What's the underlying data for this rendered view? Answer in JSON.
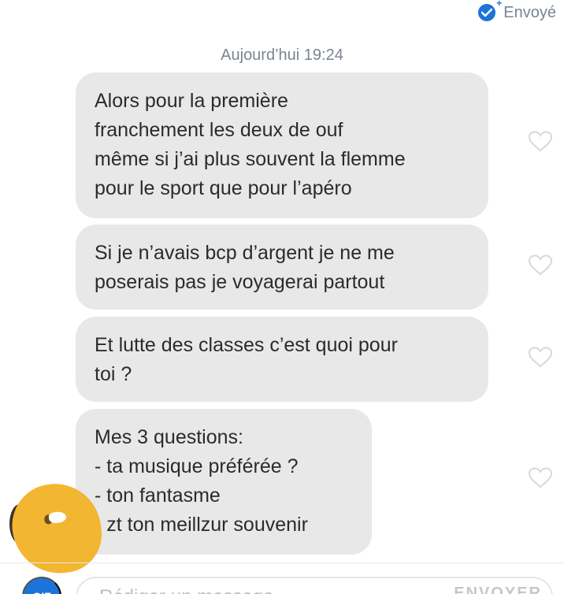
{
  "header": {
    "status_text": "Envoyé",
    "status_icon": "sent-check-icon"
  },
  "conversation": {
    "date_label": "Aujourd’hui 19:24",
    "messages": [
      {
        "text": "Alors pour la première\nfranchement les deux de ouf\nmême si j’ai plus souvent la flemme\npour le sport que pour l’apéro",
        "like_icon": "heart-outline-icon"
      },
      {
        "text": "Si je n’avais bcp d’argent je ne me\nposerais pas je voyagerai partout",
        "like_icon": "heart-outline-icon"
      },
      {
        "text": "Et lutte des classes c’est quoi pour\ntoi ?",
        "like_icon": "heart-outline-icon"
      },
      {
        "text": "Mes 3 questions:\n- ta musique préférée ?\n- ton fantasme\n- zt ton meillzur souvenir",
        "like_icon": "heart-outline-icon"
      }
    ]
  },
  "composer": {
    "gif_label": "GIF",
    "input_placeholder": "Rédiger un message",
    "send_label": "ENVOYER"
  },
  "colors": {
    "accent": "#1e73d8",
    "bubble_bg": "#e8e8e8",
    "muted_text": "#7b8490",
    "redaction": "#f2b630"
  }
}
